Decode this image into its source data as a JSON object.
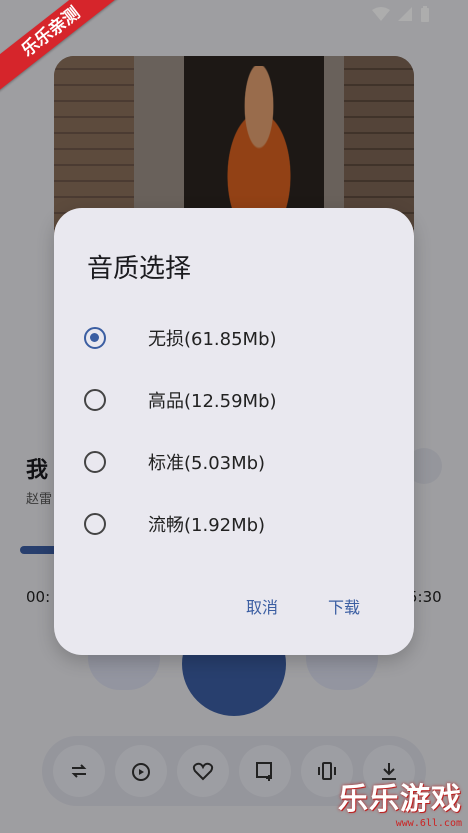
{
  "badge": {
    "text": "乐乐亲测"
  },
  "song": {
    "title": "我",
    "artist": "赵雷"
  },
  "player": {
    "time_current": "00:",
    "time_total": "5:30"
  },
  "dialog": {
    "title": "音质选择",
    "options": [
      {
        "label": "无损(61.85Mb)",
        "selected": true
      },
      {
        "label": "高品(12.59Mb)",
        "selected": false
      },
      {
        "label": "标准(5.03Mb)",
        "selected": false
      },
      {
        "label": "流畅(1.92Mb)",
        "selected": false
      }
    ],
    "cancel": "取消",
    "download": "下载"
  },
  "watermark": {
    "brand": "乐乐游戏",
    "url": "www.6ll.com"
  },
  "colors": {
    "accent": "#3b5ea2",
    "dialog_bg": "#e9e8ef"
  },
  "toolbar_icons": [
    "repeat-icon",
    "timer-icon",
    "heart-icon",
    "playlist-add-icon",
    "vibrate-icon",
    "download-icon"
  ]
}
